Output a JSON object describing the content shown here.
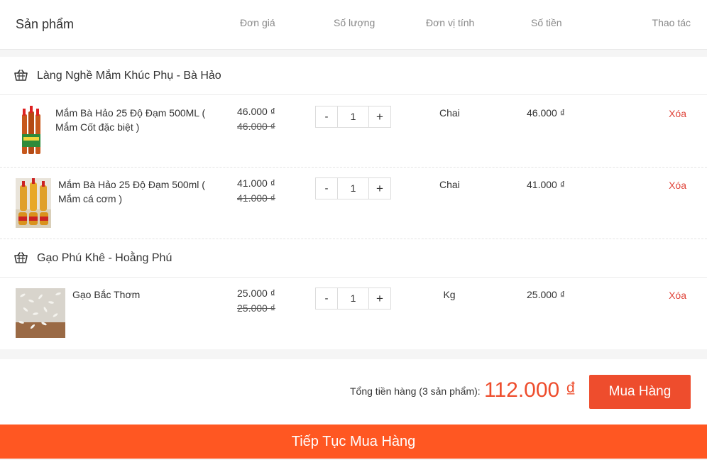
{
  "header": {
    "product": "Sản phẩm",
    "unit_price": "Đơn giá",
    "quantity": "Số lượng",
    "unit": "Đơn vị tính",
    "amount": "Số tiền",
    "action": "Thao tác"
  },
  "shops": [
    {
      "name": "Làng Nghề Mắm Khúc Phụ - Bà Hảo",
      "items": [
        {
          "name": "Mắm Bà Hảo 25 Độ Đạm 500ML ( Mắm Cốt đặc biệt )",
          "price": "46.000 ₫",
          "old_price": "46.000 ₫",
          "qty": "1",
          "unit": "Chai",
          "amount": "46.000 ₫",
          "delete_label": "Xóa"
        },
        {
          "name": "Mắm Bà Hảo 25 Độ Đạm 500ml ( Mắm cá cơm )",
          "price": "41.000 ₫",
          "old_price": "41.000 ₫",
          "qty": "1",
          "unit": "Chai",
          "amount": "41.000 ₫",
          "delete_label": "Xóa"
        }
      ]
    },
    {
      "name": "Gạo Phú Khê - Hoằng Phú",
      "items": [
        {
          "name": "Gạo Bắc Thơm",
          "price": "25.000 ₫",
          "old_price": "25.000 ₫",
          "qty": "1",
          "unit": "Kg",
          "amount": "25.000 ₫",
          "delete_label": "Xóa"
        }
      ]
    }
  ],
  "stepper": {
    "minus": "-",
    "plus": "+"
  },
  "summary": {
    "total_label": "Tổng tiền hàng (3 sản phẩm):",
    "total_value": "112.000 ₫",
    "buy_label": "Mua Hàng"
  },
  "continue_label": "Tiếp Tục Mua Hàng",
  "colors": {
    "accent": "#ee4d2d",
    "continue": "#ff5722",
    "delete": "#e0453b"
  },
  "icons": {
    "shop": "basket-icon"
  }
}
